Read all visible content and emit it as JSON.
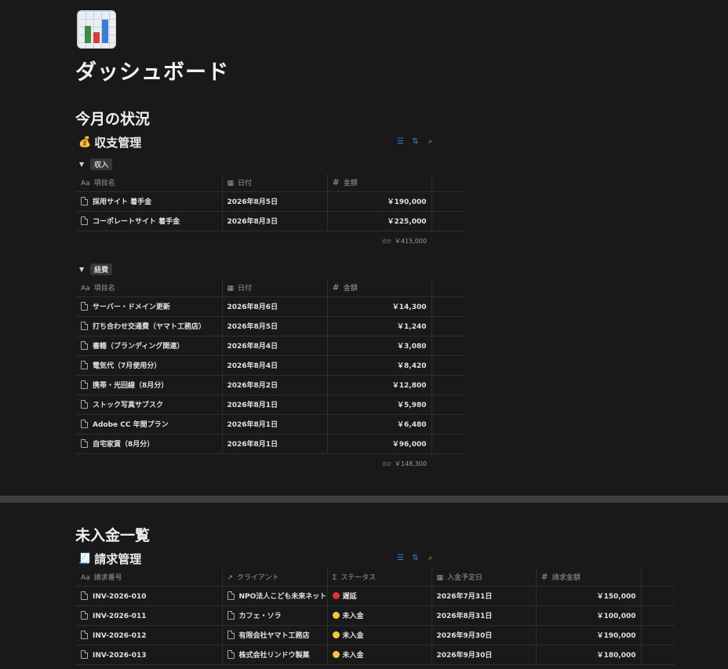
{
  "page": {
    "title": "ダッシュボード",
    "icon": "bar-chart-icon"
  },
  "colors": {
    "background": "#191919",
    "accent": "#2f83d8",
    "overdue": "#e0303c",
    "unpaid": "#f5c544"
  },
  "section1": {
    "heading": "今月の状況",
    "database": {
      "title": "収支管理",
      "icon": "money-bag-icon",
      "tools": [
        "filter-icon",
        "sort-icon",
        "search-icon"
      ],
      "columns": {
        "name": "項目名",
        "date": "日付",
        "amount": "金額"
      },
      "groups": [
        {
          "label": "収入",
          "rows": [
            {
              "name": "採用サイト 着手金",
              "date": "2026年8月5日",
              "amount": "￥190,000"
            },
            {
              "name": "コーポレートサイト 着手金",
              "date": "2026年8月3日",
              "amount": "￥225,000"
            }
          ],
          "sum_label": "合計",
          "sum": "￥415,000"
        },
        {
          "label": "経費",
          "rows": [
            {
              "name": "サーバー・ドメイン更新",
              "date": "2026年8月6日",
              "amount": "￥14,300"
            },
            {
              "name": "打ち合わせ交通費（ヤマト工務店）",
              "date": "2026年8月5日",
              "amount": "￥1,240"
            },
            {
              "name": "書籍（ブランディング関連）",
              "date": "2026年8月4日",
              "amount": "￥3,080"
            },
            {
              "name": "電気代（7月使用分）",
              "date": "2026年8月4日",
              "amount": "￥8,420"
            },
            {
              "name": "携帯・光回線（8月分）",
              "date": "2026年8月2日",
              "amount": "￥12,800"
            },
            {
              "name": "ストック写真サブスク",
              "date": "2026年8月1日",
              "amount": "￥5,980"
            },
            {
              "name": "Adobe CC 年間プラン",
              "date": "2026年8月1日",
              "amount": "￥6,480"
            },
            {
              "name": "自宅家賃（8月分）",
              "date": "2026年8月1日",
              "amount": "￥96,000"
            }
          ],
          "sum_label": "合計",
          "sum": "￥148,300"
        }
      ]
    }
  },
  "section2": {
    "heading": "未入金一覧",
    "database": {
      "title": "請求管理",
      "icon": "invoice-icon",
      "tools": [
        "filter-icon",
        "sort-icon",
        "search-icon"
      ],
      "columns": {
        "invoice": "請求番号",
        "client": "クライアント",
        "status": "ステータス",
        "due": "入金予定日",
        "amount": "請求金額"
      },
      "rows": [
        {
          "invoice": "INV-2026-010",
          "client": "NPO法人こども未来ネットワーク",
          "status": "遅延",
          "status_color": "#e0303c",
          "due": "2026年7月31日",
          "amount": "￥150,000"
        },
        {
          "invoice": "INV-2026-011",
          "client": "カフェ・ソラ",
          "status": "未入金",
          "status_color": "#f5c544",
          "due": "2026年8月31日",
          "amount": "￥100,000"
        },
        {
          "invoice": "INV-2026-012",
          "client": "有限会社ヤマト工務店",
          "status": "未入金",
          "status_color": "#f5c544",
          "due": "2026年9月30日",
          "amount": "￥190,000"
        },
        {
          "invoice": "INV-2026-013",
          "client": "株式会社リンドウ製菓",
          "status": "未入金",
          "status_color": "#f5c544",
          "due": "2026年9月30日",
          "amount": "￥180,000"
        }
      ]
    }
  }
}
